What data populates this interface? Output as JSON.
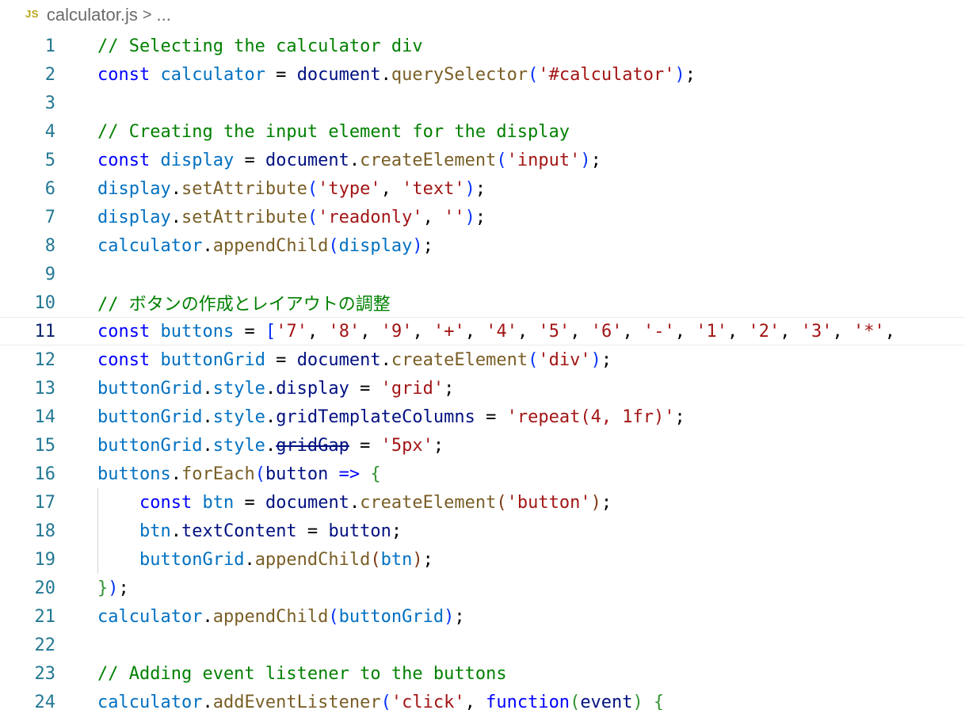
{
  "breadcrumb": {
    "file_icon": "JS",
    "file_name": "calculator.js",
    "separator": ">",
    "trail": "..."
  },
  "colors": {
    "comment": "#008000",
    "keyword": "#0000ff",
    "variable": "#0070c1",
    "object": "#001080",
    "function": "#795e26",
    "string": "#a31515",
    "line_number": "#237893",
    "active_line_number": "#0b216f"
  },
  "active_line": 11,
  "lines": [
    {
      "n": "1",
      "tokens": [
        {
          "c": "com",
          "t": "// Selecting the calculator div"
        }
      ]
    },
    {
      "n": "2",
      "tokens": [
        {
          "c": "kw",
          "t": "const"
        },
        {
          "c": "pl",
          "t": " "
        },
        {
          "c": "var",
          "t": "calculator"
        },
        {
          "c": "pl",
          "t": " = "
        },
        {
          "c": "obj",
          "t": "document"
        },
        {
          "c": "pl",
          "t": "."
        },
        {
          "c": "fn",
          "t": "querySelector"
        },
        {
          "c": "b1",
          "t": "("
        },
        {
          "c": "str",
          "t": "'#calculator'"
        },
        {
          "c": "b1",
          "t": ")"
        },
        {
          "c": "pl",
          "t": ";"
        }
      ]
    },
    {
      "n": "3",
      "tokens": []
    },
    {
      "n": "4",
      "tokens": [
        {
          "c": "com",
          "t": "// Creating the input element for the display"
        }
      ]
    },
    {
      "n": "5",
      "tokens": [
        {
          "c": "kw",
          "t": "const"
        },
        {
          "c": "pl",
          "t": " "
        },
        {
          "c": "var",
          "t": "display"
        },
        {
          "c": "pl",
          "t": " = "
        },
        {
          "c": "obj",
          "t": "document"
        },
        {
          "c": "pl",
          "t": "."
        },
        {
          "c": "fn",
          "t": "createElement"
        },
        {
          "c": "b1",
          "t": "("
        },
        {
          "c": "str",
          "t": "'input'"
        },
        {
          "c": "b1",
          "t": ")"
        },
        {
          "c": "pl",
          "t": ";"
        }
      ]
    },
    {
      "n": "6",
      "tokens": [
        {
          "c": "var",
          "t": "display"
        },
        {
          "c": "pl",
          "t": "."
        },
        {
          "c": "fn",
          "t": "setAttribute"
        },
        {
          "c": "b1",
          "t": "("
        },
        {
          "c": "str",
          "t": "'type'"
        },
        {
          "c": "pl",
          "t": ", "
        },
        {
          "c": "str",
          "t": "'text'"
        },
        {
          "c": "b1",
          "t": ")"
        },
        {
          "c": "pl",
          "t": ";"
        }
      ]
    },
    {
      "n": "7",
      "tokens": [
        {
          "c": "var",
          "t": "display"
        },
        {
          "c": "pl",
          "t": "."
        },
        {
          "c": "fn",
          "t": "setAttribute"
        },
        {
          "c": "b1",
          "t": "("
        },
        {
          "c": "str",
          "t": "'readonly'"
        },
        {
          "c": "pl",
          "t": ", "
        },
        {
          "c": "str",
          "t": "''"
        },
        {
          "c": "b1",
          "t": ")"
        },
        {
          "c": "pl",
          "t": ";"
        }
      ]
    },
    {
      "n": "8",
      "tokens": [
        {
          "c": "var",
          "t": "calculator"
        },
        {
          "c": "pl",
          "t": "."
        },
        {
          "c": "fn",
          "t": "appendChild"
        },
        {
          "c": "b1",
          "t": "("
        },
        {
          "c": "var",
          "t": "display"
        },
        {
          "c": "b1",
          "t": ")"
        },
        {
          "c": "pl",
          "t": ";"
        }
      ]
    },
    {
      "n": "9",
      "tokens": []
    },
    {
      "n": "10",
      "tokens": [
        {
          "c": "com",
          "t": "// ボタンの作成とレイアウトの調整"
        }
      ]
    },
    {
      "n": "11",
      "tokens": [
        {
          "c": "kw",
          "t": "const"
        },
        {
          "c": "pl",
          "t": " "
        },
        {
          "c": "var",
          "t": "buttons"
        },
        {
          "c": "pl",
          "t": " = "
        },
        {
          "c": "b1",
          "t": "["
        },
        {
          "c": "str",
          "t": "'7'"
        },
        {
          "c": "pl",
          "t": ", "
        },
        {
          "c": "str",
          "t": "'8'"
        },
        {
          "c": "pl",
          "t": ", "
        },
        {
          "c": "str",
          "t": "'9'"
        },
        {
          "c": "pl",
          "t": ", "
        },
        {
          "c": "str",
          "t": "'+'"
        },
        {
          "c": "pl",
          "t": ", "
        },
        {
          "c": "str",
          "t": "'4'"
        },
        {
          "c": "pl",
          "t": ", "
        },
        {
          "c": "str",
          "t": "'5'"
        },
        {
          "c": "pl",
          "t": ", "
        },
        {
          "c": "str",
          "t": "'6'"
        },
        {
          "c": "pl",
          "t": ", "
        },
        {
          "c": "str",
          "t": "'-'"
        },
        {
          "c": "pl",
          "t": ", "
        },
        {
          "c": "str",
          "t": "'1'"
        },
        {
          "c": "pl",
          "t": ", "
        },
        {
          "c": "str",
          "t": "'2'"
        },
        {
          "c": "pl",
          "t": ", "
        },
        {
          "c": "str",
          "t": "'3'"
        },
        {
          "c": "pl",
          "t": ", "
        },
        {
          "c": "str",
          "t": "'*'"
        },
        {
          "c": "pl",
          "t": ","
        }
      ]
    },
    {
      "n": "12",
      "tokens": [
        {
          "c": "kw",
          "t": "const"
        },
        {
          "c": "pl",
          "t": " "
        },
        {
          "c": "var",
          "t": "buttonGrid"
        },
        {
          "c": "pl",
          "t": " = "
        },
        {
          "c": "obj",
          "t": "document"
        },
        {
          "c": "pl",
          "t": "."
        },
        {
          "c": "fn",
          "t": "createElement"
        },
        {
          "c": "b1",
          "t": "("
        },
        {
          "c": "str",
          "t": "'div'"
        },
        {
          "c": "b1",
          "t": ")"
        },
        {
          "c": "pl",
          "t": ";"
        }
      ]
    },
    {
      "n": "13",
      "tokens": [
        {
          "c": "var",
          "t": "buttonGrid"
        },
        {
          "c": "pl",
          "t": "."
        },
        {
          "c": "var",
          "t": "style"
        },
        {
          "c": "pl",
          "t": "."
        },
        {
          "c": "obj",
          "t": "display"
        },
        {
          "c": "pl",
          "t": " = "
        },
        {
          "c": "str",
          "t": "'grid'"
        },
        {
          "c": "pl",
          "t": ";"
        }
      ]
    },
    {
      "n": "14",
      "tokens": [
        {
          "c": "var",
          "t": "buttonGrid"
        },
        {
          "c": "pl",
          "t": "."
        },
        {
          "c": "var",
          "t": "style"
        },
        {
          "c": "pl",
          "t": "."
        },
        {
          "c": "obj",
          "t": "gridTemplateColumns"
        },
        {
          "c": "pl",
          "t": " = "
        },
        {
          "c": "str",
          "t": "'repeat(4, 1fr)'"
        },
        {
          "c": "pl",
          "t": ";"
        }
      ]
    },
    {
      "n": "15",
      "tokens": [
        {
          "c": "var",
          "t": "buttonGrid"
        },
        {
          "c": "pl",
          "t": "."
        },
        {
          "c": "var",
          "t": "style"
        },
        {
          "c": "pl",
          "t": "."
        },
        {
          "c": "dep",
          "t": "gridGap"
        },
        {
          "c": "pl",
          "t": " = "
        },
        {
          "c": "str",
          "t": "'5px'"
        },
        {
          "c": "pl",
          "t": ";"
        }
      ]
    },
    {
      "n": "16",
      "tokens": [
        {
          "c": "var",
          "t": "buttons"
        },
        {
          "c": "pl",
          "t": "."
        },
        {
          "c": "fn",
          "t": "forEach"
        },
        {
          "c": "b1",
          "t": "("
        },
        {
          "c": "obj",
          "t": "button"
        },
        {
          "c": "pl",
          "t": " "
        },
        {
          "c": "kw",
          "t": "=>"
        },
        {
          "c": "pl",
          "t": " "
        },
        {
          "c": "b2",
          "t": "{"
        }
      ]
    },
    {
      "n": "17",
      "indent": true,
      "tokens": [
        {
          "c": "pl",
          "t": "    "
        },
        {
          "c": "kw",
          "t": "const"
        },
        {
          "c": "pl",
          "t": " "
        },
        {
          "c": "var",
          "t": "btn"
        },
        {
          "c": "pl",
          "t": " = "
        },
        {
          "c": "obj",
          "t": "document"
        },
        {
          "c": "pl",
          "t": "."
        },
        {
          "c": "fn",
          "t": "createElement"
        },
        {
          "c": "b3",
          "t": "("
        },
        {
          "c": "str",
          "t": "'button'"
        },
        {
          "c": "b3",
          "t": ")"
        },
        {
          "c": "pl",
          "t": ";"
        }
      ]
    },
    {
      "n": "18",
      "indent": true,
      "tokens": [
        {
          "c": "pl",
          "t": "    "
        },
        {
          "c": "var",
          "t": "btn"
        },
        {
          "c": "pl",
          "t": "."
        },
        {
          "c": "obj",
          "t": "textContent"
        },
        {
          "c": "pl",
          "t": " = "
        },
        {
          "c": "obj",
          "t": "button"
        },
        {
          "c": "pl",
          "t": ";"
        }
      ]
    },
    {
      "n": "19",
      "indent": true,
      "tokens": [
        {
          "c": "pl",
          "t": "    "
        },
        {
          "c": "var",
          "t": "buttonGrid"
        },
        {
          "c": "pl",
          "t": "."
        },
        {
          "c": "fn",
          "t": "appendChild"
        },
        {
          "c": "b3",
          "t": "("
        },
        {
          "c": "var",
          "t": "btn"
        },
        {
          "c": "b3",
          "t": ")"
        },
        {
          "c": "pl",
          "t": ";"
        }
      ]
    },
    {
      "n": "20",
      "tokens": [
        {
          "c": "b2",
          "t": "}"
        },
        {
          "c": "b1",
          "t": ")"
        },
        {
          "c": "pl",
          "t": ";"
        }
      ]
    },
    {
      "n": "21",
      "tokens": [
        {
          "c": "var",
          "t": "calculator"
        },
        {
          "c": "pl",
          "t": "."
        },
        {
          "c": "fn",
          "t": "appendChild"
        },
        {
          "c": "b1",
          "t": "("
        },
        {
          "c": "var",
          "t": "buttonGrid"
        },
        {
          "c": "b1",
          "t": ")"
        },
        {
          "c": "pl",
          "t": ";"
        }
      ]
    },
    {
      "n": "22",
      "tokens": []
    },
    {
      "n": "23",
      "tokens": [
        {
          "c": "com",
          "t": "// Adding event listener to the buttons"
        }
      ]
    },
    {
      "n": "24",
      "tokens": [
        {
          "c": "var",
          "t": "calculator"
        },
        {
          "c": "pl",
          "t": "."
        },
        {
          "c": "fn",
          "t": "addEventListener"
        },
        {
          "c": "b1",
          "t": "("
        },
        {
          "c": "str",
          "t": "'click'"
        },
        {
          "c": "pl",
          "t": ", "
        },
        {
          "c": "kw",
          "t": "function"
        },
        {
          "c": "b2",
          "t": "("
        },
        {
          "c": "obj",
          "t": "event"
        },
        {
          "c": "b2",
          "t": ")"
        },
        {
          "c": "pl",
          "t": " "
        },
        {
          "c": "b2",
          "t": "{"
        }
      ]
    }
  ]
}
